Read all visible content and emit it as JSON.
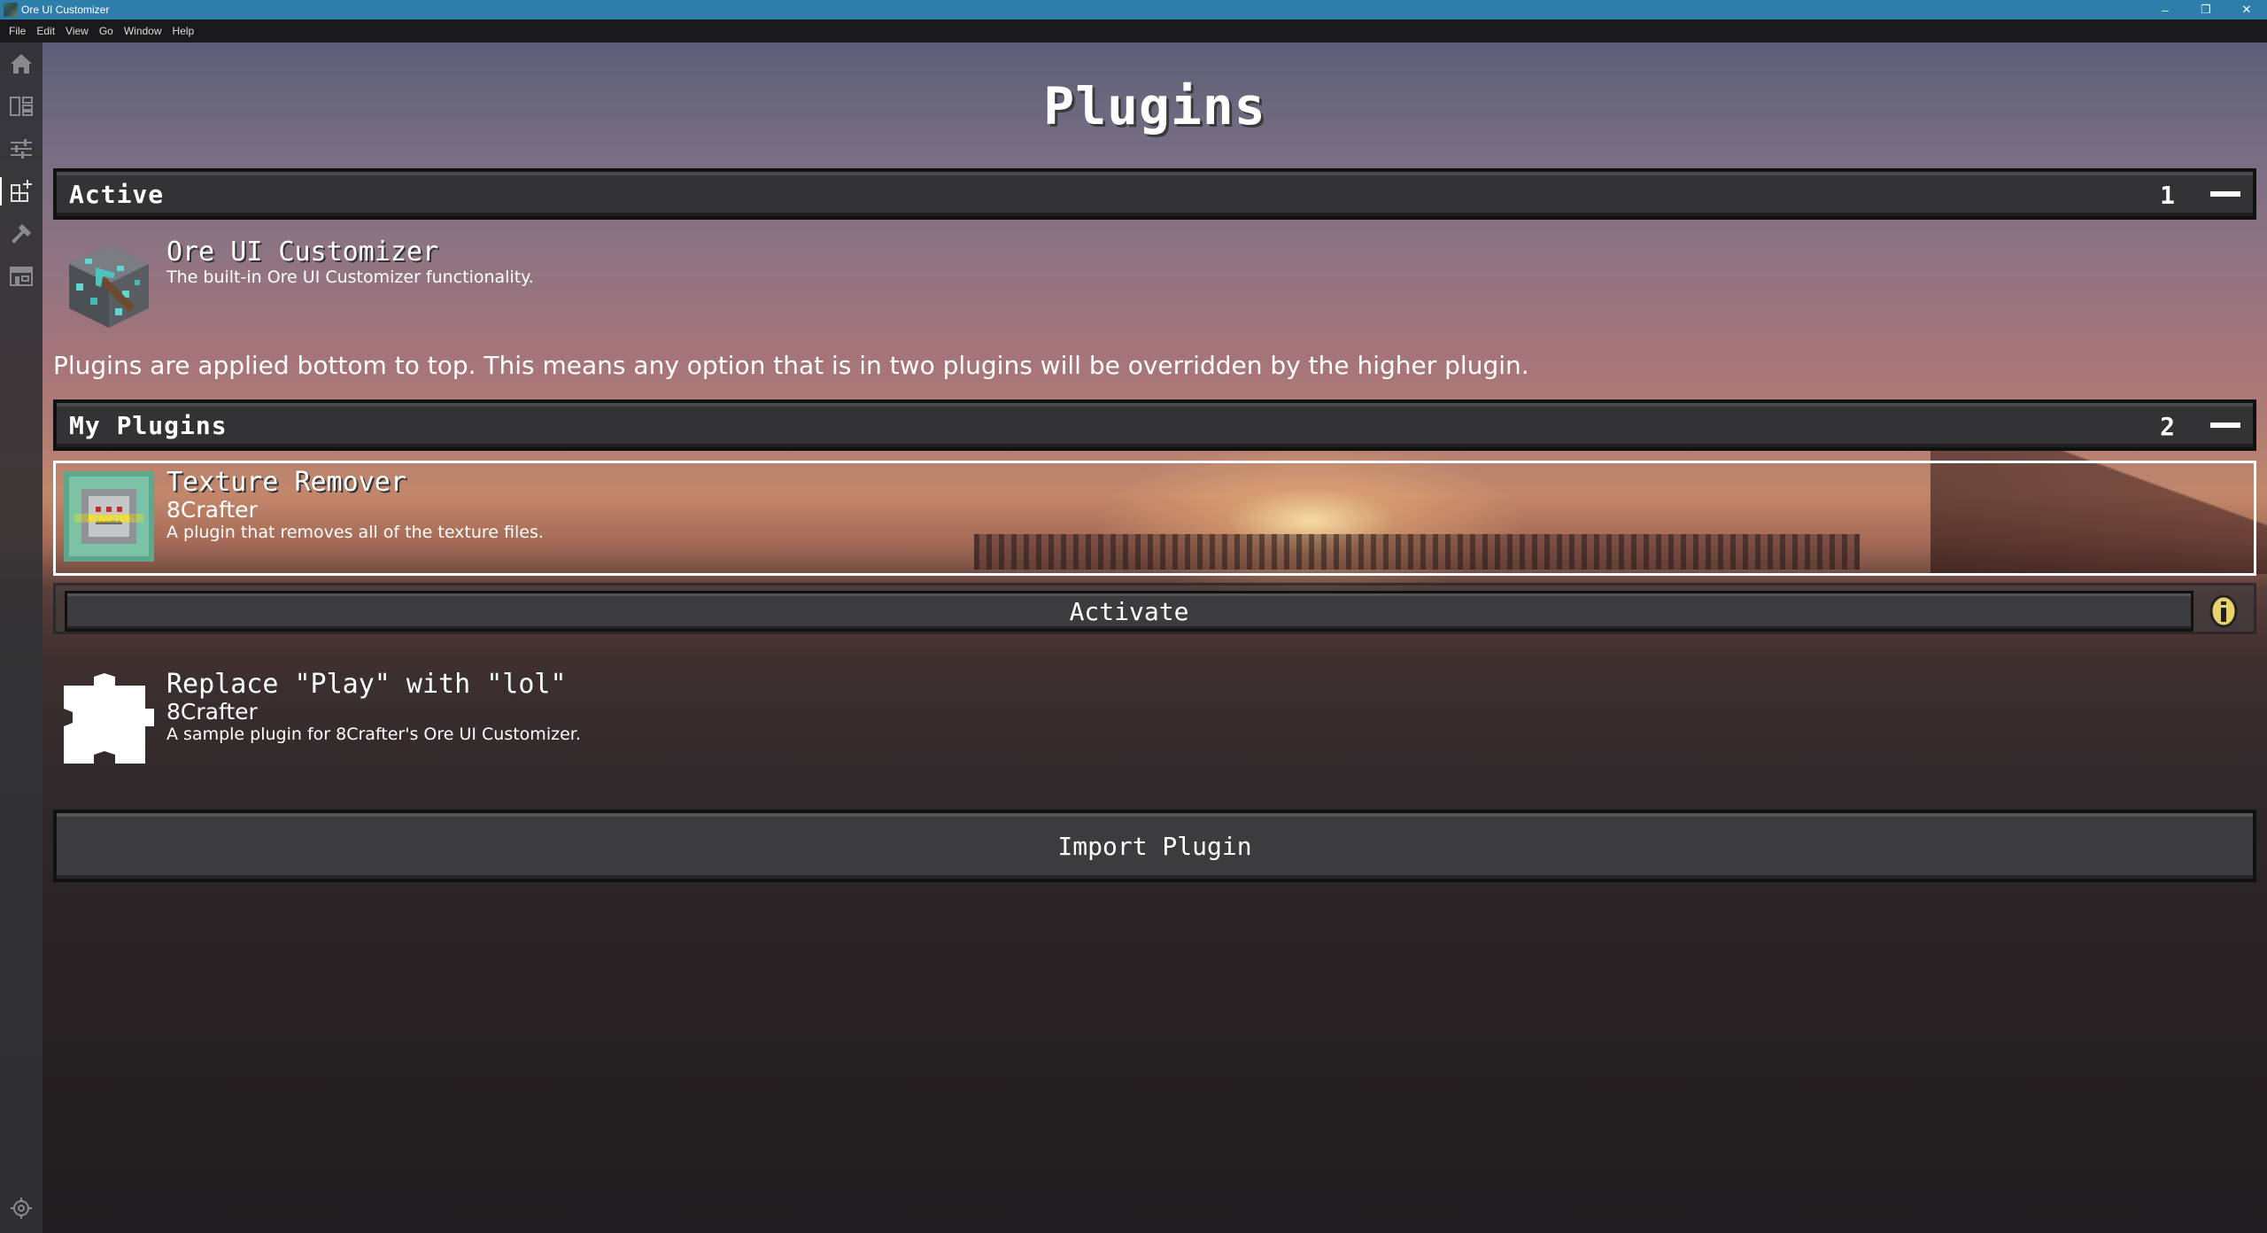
{
  "window": {
    "title": "Ore UI Customizer",
    "controls": [
      "–",
      "❐",
      "✕"
    ]
  },
  "menu": [
    "File",
    "Edit",
    "View",
    "Go",
    "Window",
    "Help"
  ],
  "sidebar": {
    "items": [
      {
        "icon": "home-icon",
        "active": false
      },
      {
        "icon": "tree-icon",
        "active": false
      },
      {
        "icon": "sliders-icon",
        "active": false
      },
      {
        "icon": "plugins-icon",
        "active": true
      },
      {
        "icon": "hammer-icon",
        "active": false
      },
      {
        "icon": "store-icon",
        "active": false
      }
    ],
    "bottom_icon": "gear-icon"
  },
  "page": {
    "title": "Plugins"
  },
  "active_section": {
    "label": "Active",
    "count": "1",
    "plugins": [
      {
        "title": "Ore UI Customizer",
        "description": "The built-in Ore UI Customizer functionality."
      }
    ]
  },
  "info_text": "Plugins are applied bottom to top. This means any option that is in two plugins will be overridden by the higher plugin.",
  "my_plugins_section": {
    "label": "My Plugins",
    "count": "2",
    "plugins": [
      {
        "title": "Texture Remover",
        "author": "8Crafter",
        "description": "A plugin that removes all of the texture files.",
        "selected": true
      },
      {
        "title": "Replace \"Play\" with \"lol\"",
        "author": "8Crafter",
        "description": "A sample plugin for 8Crafter's Ore UI Customizer.",
        "selected": false
      }
    ],
    "activate_label": "Activate"
  },
  "import_label": "Import Plugin",
  "colors": {
    "titlebar": "#2e7eac",
    "menubar": "#19191b",
    "header_bg": "#333335",
    "button_bg": "#3c3c3e"
  }
}
